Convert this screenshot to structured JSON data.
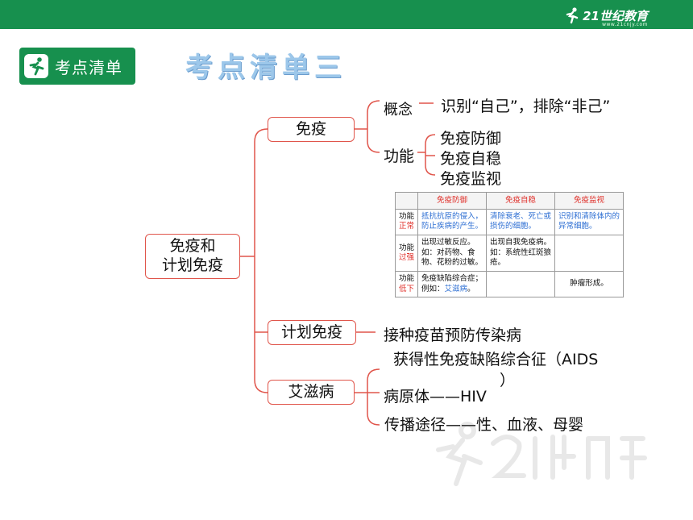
{
  "header": {
    "brand": "21世纪教育",
    "brand_url": "www.21cnjy.com"
  },
  "badge": {
    "label": "考点清单",
    "icon": "runner-icon"
  },
  "title": "考点清单三",
  "mindmap": {
    "root": [
      "免疫和",
      "计划免疫"
    ],
    "immunity": {
      "label": "免疫",
      "concept_label": "概念",
      "concept_text": "识别“自己”，排除“非己”",
      "function_label": "功能",
      "functions": [
        "免疫防御",
        "免疫自稳",
        "免疫监视"
      ]
    },
    "planned": {
      "label": "计划免疫",
      "text": "接种疫苗预防传染病"
    },
    "aids": {
      "label": "艾滋病",
      "line1": "获得性免疫缺陷综合征（AIDS",
      "line1_end": "）",
      "line2": "病原体——HIV",
      "line3": "传播途径——性、血液、母婴"
    }
  },
  "table": {
    "headers": [
      "",
      "免疫防御",
      "免疫自稳",
      "免疫监视"
    ],
    "rows": [
      {
        "h1": "功能",
        "h2": "正常",
        "c1": "抵抗抗原的侵入，防止疾病的产生。",
        "c2": "清除衰老、死亡或损伤的细胞。",
        "c3": "识别和清除体内的异常细胞。"
      },
      {
        "h1": "功能",
        "h2": "过强",
        "c1a": "出现过敏反应。",
        "c1b": "如：对药物、食物、花粉的过敏。",
        "c2": "出现自我免疫病。如：系统性红斑狼疮。",
        "c3": ""
      },
      {
        "h1": "功能",
        "h2": "低下",
        "c1a": "免疫缺陷综合症；",
        "c1b_prefix": "例如：",
        "c1b_em": "艾滋病",
        "c1b_suffix": "。",
        "c2": "",
        "c3": "肿瘤形成。"
      }
    ]
  },
  "colors": {
    "green": "#17904e",
    "node_border": "#e0554b",
    "title": "#9cc7ea",
    "table_red": "#e0312b",
    "table_blue": "#2e6fd3"
  }
}
